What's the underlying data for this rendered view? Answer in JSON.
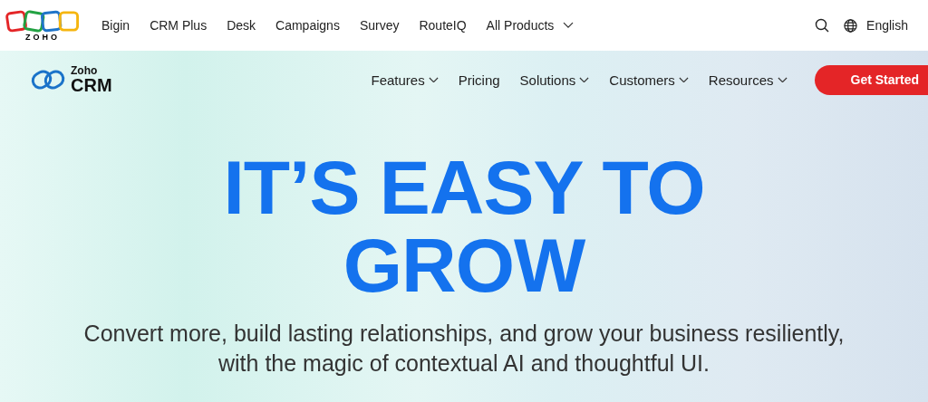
{
  "top_bar": {
    "logo_text": "ZOHO",
    "links": [
      "Bigin",
      "CRM Plus",
      "Desk",
      "Campaigns",
      "Survey",
      "RouteIQ"
    ],
    "all_products": "All Products",
    "language": "English"
  },
  "product_nav": {
    "logo": {
      "brand": "Zoho",
      "product": "CRM"
    },
    "items": [
      {
        "label": "Features",
        "dropdown": true
      },
      {
        "label": "Pricing",
        "dropdown": false
      },
      {
        "label": "Solutions",
        "dropdown": true
      },
      {
        "label": "Customers",
        "dropdown": true
      },
      {
        "label": "Resources",
        "dropdown": true
      }
    ],
    "cta": "Get Started"
  },
  "hero": {
    "headline": [
      "IT’S EASY TO",
      "GROW"
    ],
    "subtitle": [
      "Convert more, build lasting relationships, and grow your business resiliently,",
      "with the magic of contextual AI and thoughtful UI."
    ]
  }
}
